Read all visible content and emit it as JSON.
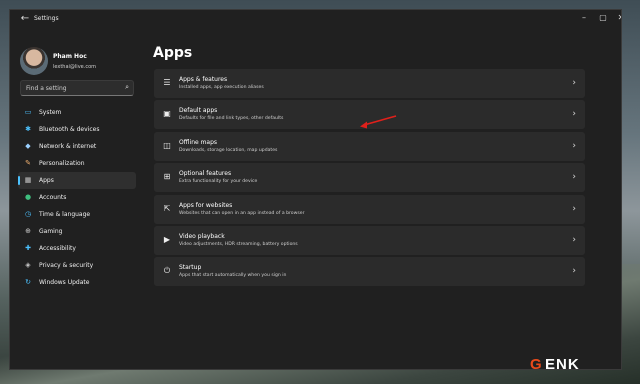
{
  "window": {
    "title": "Settings"
  },
  "user": {
    "name": "Pham Hoc",
    "email": "lexthai@live.com"
  },
  "search": {
    "placeholder": "Find a setting"
  },
  "nav": [
    {
      "label": "System",
      "icon": "system-icon",
      "color": "#4cc2ff"
    },
    {
      "label": "Bluetooth & devices",
      "icon": "bluetooth-icon",
      "color": "#4cc2ff"
    },
    {
      "label": "Network & internet",
      "icon": "network-icon",
      "color": "#9ad0ff"
    },
    {
      "label": "Personalization",
      "icon": "brush-icon",
      "color": "#f0b070"
    },
    {
      "label": "Apps",
      "icon": "apps-icon",
      "color": "#c9c9c9",
      "active": true
    },
    {
      "label": "Accounts",
      "icon": "person-icon",
      "color": "#3fbf7f"
    },
    {
      "label": "Time & language",
      "icon": "globe-clock-icon",
      "color": "#4cc2ff"
    },
    {
      "label": "Gaming",
      "icon": "controller-icon",
      "color": "#c9c9c9"
    },
    {
      "label": "Accessibility",
      "icon": "accessibility-icon",
      "color": "#4cc2ff"
    },
    {
      "label": "Privacy & security",
      "icon": "shield-icon",
      "color": "#c9c9c9"
    },
    {
      "label": "Windows Update",
      "icon": "update-icon",
      "color": "#4cc2ff"
    }
  ],
  "main": {
    "title": "Apps",
    "cards": [
      {
        "title": "Apps & features",
        "subtitle": "Installed apps, app execution aliases",
        "icon": "list-icon"
      },
      {
        "title": "Default apps",
        "subtitle": "Defaults for file and link types, other defaults",
        "icon": "default-apps-icon"
      },
      {
        "title": "Offline maps",
        "subtitle": "Downloads, storage location, map updates",
        "icon": "map-icon"
      },
      {
        "title": "Optional features",
        "subtitle": "Extra functionality for your device",
        "icon": "grid-plus-icon"
      },
      {
        "title": "Apps for websites",
        "subtitle": "Websites that can open in an app instead of a browser",
        "icon": "open-link-icon"
      },
      {
        "title": "Video playback",
        "subtitle": "Video adjustments, HDR streaming, battery options",
        "icon": "video-icon"
      },
      {
        "title": "Startup",
        "subtitle": "Apps that start automatically when you sign in",
        "icon": "startup-icon"
      }
    ]
  },
  "annotation_color": "#e0201b",
  "watermark": {
    "first": "G",
    "rest": "ENK"
  }
}
